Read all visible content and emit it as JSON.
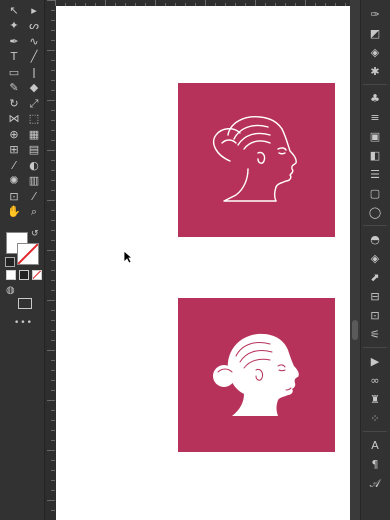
{
  "app": {
    "accent": "#b7325a",
    "canvas_color": "#ffffff",
    "chrome_color": "#323232"
  },
  "left_toolbar": {
    "tools": [
      {
        "name": "selection-tool",
        "glyph": "↖"
      },
      {
        "name": "direct-selection-tool",
        "glyph": "▸"
      },
      {
        "name": "magic-wand-tool",
        "glyph": "✦"
      },
      {
        "name": "lasso-tool",
        "glyph": "ᔕ"
      },
      {
        "name": "pen-tool",
        "glyph": "✒"
      },
      {
        "name": "curvature-tool",
        "glyph": "∿"
      },
      {
        "name": "type-tool",
        "glyph": "T"
      },
      {
        "name": "line-tool",
        "glyph": "╱"
      },
      {
        "name": "rectangle-tool",
        "glyph": "▭"
      },
      {
        "name": "paintbrush-tool",
        "glyph": "ǀ"
      },
      {
        "name": "shaper-tool",
        "glyph": "✎"
      },
      {
        "name": "eraser-tool",
        "glyph": "◆"
      },
      {
        "name": "rotate-tool",
        "glyph": "↻"
      },
      {
        "name": "scale-tool",
        "glyph": "⤢"
      },
      {
        "name": "width-tool",
        "glyph": "⋈"
      },
      {
        "name": "free-transform-tool",
        "glyph": "⬚"
      },
      {
        "name": "shape-builder-tool",
        "glyph": "⊕"
      },
      {
        "name": "perspective-grid-tool",
        "glyph": "▦"
      },
      {
        "name": "mesh-tool",
        "glyph": "⊞"
      },
      {
        "name": "gradient-tool",
        "glyph": "▤"
      },
      {
        "name": "eyedropper-tool",
        "glyph": "⁄"
      },
      {
        "name": "blend-tool",
        "glyph": "◐"
      },
      {
        "name": "symbol-sprayer-tool",
        "glyph": "✺"
      },
      {
        "name": "column-graph-tool",
        "glyph": "▥"
      },
      {
        "name": "artboard-tool",
        "glyph": "⊡"
      },
      {
        "name": "slice-tool",
        "glyph": "⁄"
      },
      {
        "name": "hand-tool",
        "glyph": "✋"
      },
      {
        "name": "zoom-tool",
        "glyph": "⌕"
      }
    ],
    "more_label": "•••"
  },
  "right_toolbar": {
    "items": [
      {
        "name": "properties-icon",
        "glyph": "✑"
      },
      {
        "name": "libraries-icon",
        "glyph": "◩"
      },
      {
        "name": "swatches-icon",
        "glyph": "◈"
      },
      {
        "name": "brushes-icon",
        "glyph": "✱"
      },
      {
        "name": "symbols-icon",
        "glyph": "♣"
      },
      {
        "name": "align-icon",
        "glyph": "≡"
      },
      {
        "name": "transform-icon",
        "glyph": "▣"
      },
      {
        "name": "pathfinder-icon",
        "glyph": "◧"
      },
      {
        "name": "stroke-icon",
        "glyph": "☰"
      },
      {
        "name": "gradient-panel-icon",
        "glyph": "▢"
      },
      {
        "name": "transparency-icon",
        "glyph": "◯"
      },
      {
        "name": "appearance-icon",
        "glyph": "◓"
      },
      {
        "name": "layers-icon",
        "glyph": "◈"
      },
      {
        "name": "export-icon",
        "glyph": "⬈"
      },
      {
        "name": "artboards-icon",
        "glyph": "⊟"
      },
      {
        "name": "links-icon",
        "glyph": "⊡"
      },
      {
        "name": "adjust-icon",
        "glyph": "⚟"
      },
      {
        "name": "actions-icon",
        "glyph": "▶"
      },
      {
        "name": "link-chain-icon",
        "glyph": "∞"
      },
      {
        "name": "shirt-icon",
        "glyph": "♜"
      },
      {
        "name": "grid-dots-icon",
        "glyph": "⁘"
      },
      {
        "name": "character-icon",
        "glyph": "A"
      },
      {
        "name": "paragraph-icon",
        "glyph": "¶"
      },
      {
        "name": "opentype-icon",
        "glyph": "𝒜"
      }
    ]
  },
  "canvas": {
    "artboards": [
      {
        "name": "artboard-line-portrait",
        "fill": "#b7325a"
      },
      {
        "name": "artboard-solid-portrait",
        "fill": "#b7325a"
      }
    ]
  }
}
